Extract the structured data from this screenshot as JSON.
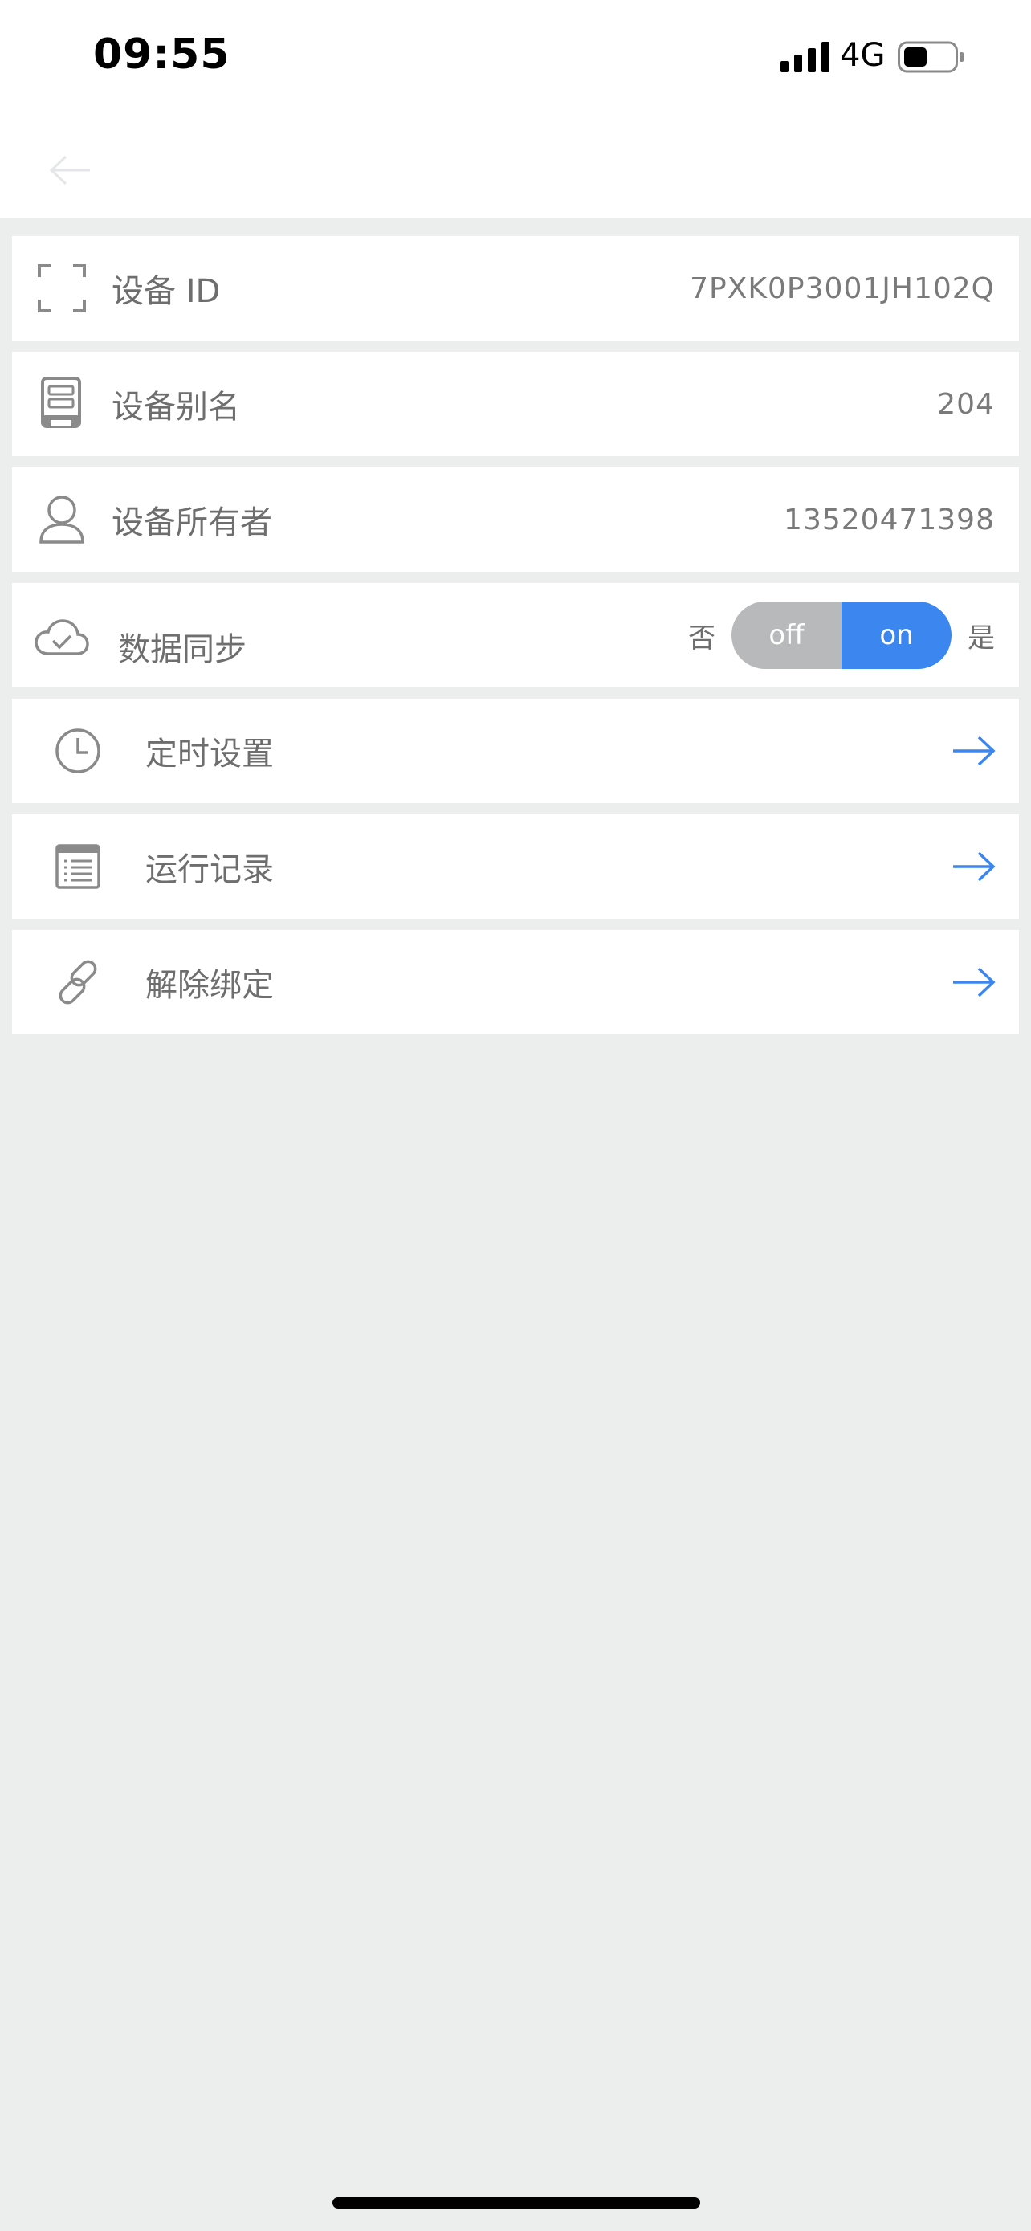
{
  "status_bar": {
    "time": "09:55",
    "network": "4G"
  },
  "nav": {
    "back_icon": "back-arrow-icon"
  },
  "rows": {
    "device_id": {
      "label": "设备 ID",
      "value": "7PXK0P3001JH102Q",
      "icon": "scan-frame-icon"
    },
    "device_alias": {
      "label": "设备别名",
      "value": "204",
      "icon": "device-icon"
    },
    "device_owner": {
      "label": "设备所有者",
      "value": "13520471398",
      "icon": "user-icon"
    },
    "data_sync": {
      "label": "数据同步",
      "icon": "cloud-check-icon",
      "no_label": "否",
      "yes_label": "是",
      "off_text": "off",
      "on_text": "on",
      "state": "on"
    },
    "timer": {
      "label": "定时设置",
      "icon": "clock-icon"
    },
    "run_log": {
      "label": "运行记录",
      "icon": "log-list-icon"
    },
    "unbind": {
      "label": "解除绑定",
      "icon": "link-icon"
    }
  },
  "colors": {
    "accent": "#3b86ef",
    "toggle_off": "#b8b9bb",
    "label": "#6e6e6e",
    "background": "#eceeee"
  }
}
